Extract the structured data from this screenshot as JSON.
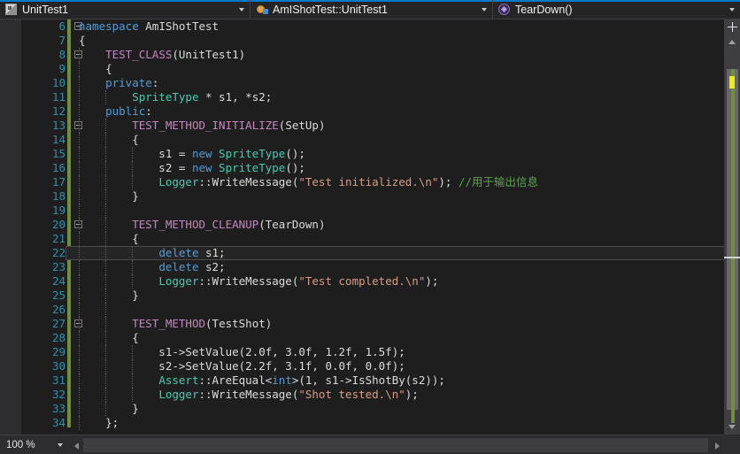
{
  "navbar": {
    "project": {
      "label": "UnitTest1",
      "icon": "project-icon"
    },
    "class": {
      "label": "AmIShotTest::UnitTest1",
      "icon": "class-icon"
    },
    "member": {
      "label": "TearDown()",
      "icon": "method-icon"
    }
  },
  "editor": {
    "first_line": 6,
    "current_line": 22,
    "lines": [
      {
        "n": 6,
        "fold": "minus",
        "guides": 0,
        "tokens": [
          {
            "t": "namespace ",
            "c": "kw"
          },
          {
            "t": "AmIShotTest",
            "c": "id"
          }
        ]
      },
      {
        "n": 7,
        "fold": "",
        "guides": 0,
        "tokens": [
          {
            "t": "{",
            "c": "pun"
          }
        ]
      },
      {
        "n": 8,
        "fold": "minus",
        "guides": 1,
        "tokens": [
          {
            "t": "    ",
            "c": "pun"
          },
          {
            "t": "TEST_CLASS",
            "c": "macro"
          },
          {
            "t": "(UnitTest1)",
            "c": "pun"
          }
        ]
      },
      {
        "n": 9,
        "fold": "",
        "guides": 1,
        "tokens": [
          {
            "t": "    {",
            "c": "pun"
          }
        ]
      },
      {
        "n": 10,
        "fold": "",
        "guides": 1,
        "tokens": [
          {
            "t": "    ",
            "c": "pun"
          },
          {
            "t": "private",
            "c": "kw"
          },
          {
            "t": ":",
            "c": "pun"
          }
        ]
      },
      {
        "n": 11,
        "fold": "",
        "guides": 2,
        "tokens": [
          {
            "t": "        ",
            "c": "pun"
          },
          {
            "t": "SpriteType",
            "c": "type"
          },
          {
            "t": " * s1, *s2;",
            "c": "pun"
          }
        ]
      },
      {
        "n": 12,
        "fold": "",
        "guides": 1,
        "tokens": [
          {
            "t": "    ",
            "c": "pun"
          },
          {
            "t": "public",
            "c": "kw"
          },
          {
            "t": ":",
            "c": "pun"
          }
        ]
      },
      {
        "n": 13,
        "fold": "minus",
        "guides": 2,
        "tokens": [
          {
            "t": "        ",
            "c": "pun"
          },
          {
            "t": "TEST_METHOD_INITIALIZE",
            "c": "macro"
          },
          {
            "t": "(SetUp)",
            "c": "pun"
          }
        ]
      },
      {
        "n": 14,
        "fold": "",
        "guides": 2,
        "tokens": [
          {
            "t": "        {",
            "c": "pun"
          }
        ]
      },
      {
        "n": 15,
        "fold": "",
        "guides": 3,
        "tokens": [
          {
            "t": "            s1 = ",
            "c": "pun"
          },
          {
            "t": "new",
            "c": "kw"
          },
          {
            "t": " ",
            "c": "pun"
          },
          {
            "t": "SpriteType",
            "c": "type"
          },
          {
            "t": "();",
            "c": "pun"
          }
        ]
      },
      {
        "n": 16,
        "fold": "",
        "guides": 3,
        "tokens": [
          {
            "t": "            s2 = ",
            "c": "pun"
          },
          {
            "t": "new",
            "c": "kw"
          },
          {
            "t": " ",
            "c": "pun"
          },
          {
            "t": "SpriteType",
            "c": "type"
          },
          {
            "t": "();",
            "c": "pun"
          }
        ]
      },
      {
        "n": 17,
        "fold": "",
        "guides": 3,
        "tokens": [
          {
            "t": "            ",
            "c": "pun"
          },
          {
            "t": "Logger",
            "c": "type"
          },
          {
            "t": "::WriteMessage(",
            "c": "pun"
          },
          {
            "t": "\"Test initialized.\\n\"",
            "c": "str"
          },
          {
            "t": "); ",
            "c": "pun"
          },
          {
            "t": "//用于输出信息",
            "c": "cmt"
          }
        ]
      },
      {
        "n": 18,
        "fold": "",
        "guides": 2,
        "tokens": [
          {
            "t": "        }",
            "c": "pun"
          }
        ]
      },
      {
        "n": 19,
        "fold": "",
        "guides": 2,
        "tokens": [
          {
            "t": "",
            "c": "pun"
          }
        ]
      },
      {
        "n": 20,
        "fold": "minus",
        "guides": 2,
        "tokens": [
          {
            "t": "        ",
            "c": "pun"
          },
          {
            "t": "TEST_METHOD_CLEANUP",
            "c": "macro"
          },
          {
            "t": "(TearDown)",
            "c": "pun"
          }
        ]
      },
      {
        "n": 21,
        "fold": "",
        "guides": 2,
        "tokens": [
          {
            "t": "        {",
            "c": "pun"
          }
        ]
      },
      {
        "n": 22,
        "fold": "",
        "guides": 3,
        "tokens": [
          {
            "t": "            ",
            "c": "pun"
          },
          {
            "t": "delete",
            "c": "kw"
          },
          {
            "t": " s1;",
            "c": "pun"
          }
        ]
      },
      {
        "n": 23,
        "fold": "",
        "guides": 3,
        "tokens": [
          {
            "t": "            ",
            "c": "pun"
          },
          {
            "t": "delete",
            "c": "kw"
          },
          {
            "t": " s2;",
            "c": "pun"
          }
        ]
      },
      {
        "n": 24,
        "fold": "",
        "guides": 3,
        "tokens": [
          {
            "t": "            ",
            "c": "pun"
          },
          {
            "t": "Logger",
            "c": "type"
          },
          {
            "t": "::WriteMessage(",
            "c": "pun"
          },
          {
            "t": "\"Test completed.\\n\"",
            "c": "str"
          },
          {
            "t": ");",
            "c": "pun"
          }
        ]
      },
      {
        "n": 25,
        "fold": "",
        "guides": 2,
        "tokens": [
          {
            "t": "        }",
            "c": "pun"
          }
        ]
      },
      {
        "n": 26,
        "fold": "",
        "guides": 2,
        "tokens": [
          {
            "t": "",
            "c": "pun"
          }
        ]
      },
      {
        "n": 27,
        "fold": "minus",
        "guides": 2,
        "tokens": [
          {
            "t": "        ",
            "c": "pun"
          },
          {
            "t": "TEST_METHOD",
            "c": "macro"
          },
          {
            "t": "(TestShot)",
            "c": "pun"
          }
        ]
      },
      {
        "n": 28,
        "fold": "",
        "guides": 2,
        "tokens": [
          {
            "t": "        {",
            "c": "pun"
          }
        ]
      },
      {
        "n": 29,
        "fold": "",
        "guides": 3,
        "tokens": [
          {
            "t": "            s1->SetValue(2.0f, 3.0f, 1.2f, 1.5f);",
            "c": "pun"
          }
        ]
      },
      {
        "n": 30,
        "fold": "",
        "guides": 3,
        "tokens": [
          {
            "t": "            s2->SetValue(2.2f, 3.1f, 0.0f, 0.0f);",
            "c": "pun"
          }
        ]
      },
      {
        "n": 31,
        "fold": "",
        "guides": 3,
        "tokens": [
          {
            "t": "            ",
            "c": "pun"
          },
          {
            "t": "Assert",
            "c": "type"
          },
          {
            "t": "::AreEqual<",
            "c": "pun"
          },
          {
            "t": "int",
            "c": "kw"
          },
          {
            "t": ">(1, s1->IsShotBy(s2));",
            "c": "pun"
          }
        ]
      },
      {
        "n": 32,
        "fold": "",
        "guides": 3,
        "tokens": [
          {
            "t": "            ",
            "c": "pun"
          },
          {
            "t": "Logger",
            "c": "type"
          },
          {
            "t": "::WriteMessage(",
            "c": "pun"
          },
          {
            "t": "\"Shot tested.\\n\"",
            "c": "str"
          },
          {
            "t": ");",
            "c": "pun"
          }
        ]
      },
      {
        "n": 33,
        "fold": "",
        "guides": 2,
        "tokens": [
          {
            "t": "        }",
            "c": "pun"
          }
        ]
      },
      {
        "n": 34,
        "fold": "",
        "guides": 1,
        "tokens": [
          {
            "t": "    };",
            "c": "pun"
          }
        ]
      }
    ]
  },
  "statusbar": {
    "zoom": "100 %"
  },
  "colors": {
    "accent": "#007acc",
    "keyword": "#569cd6",
    "type": "#4ec9b0",
    "macro": "#c586c0",
    "string": "#d69d85",
    "comment": "#57a64a",
    "linenumber": "#2b91af",
    "changebar": "#6d8f3f",
    "bookmark": "#e8e82e",
    "editor_bg": "#1e1e1e"
  }
}
